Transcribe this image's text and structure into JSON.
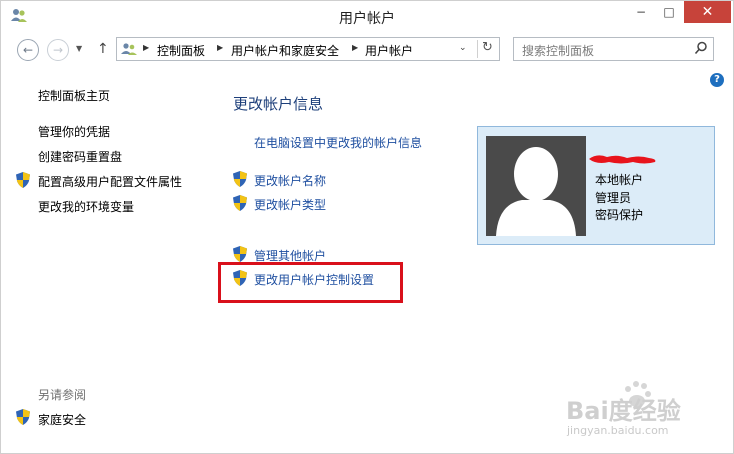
{
  "window": {
    "title": "用户帐户",
    "controls": {
      "minimize": "−",
      "maximize": "□",
      "close": "✕"
    }
  },
  "nav": {
    "back_icon": "←",
    "forward_icon": "→",
    "history_icon": "▼",
    "up_icon": "↑",
    "refresh_icon": "↻",
    "dropdown_icon": "⌄",
    "breadcrumb": [
      "控制面板",
      "用户帐户和家庭安全",
      "用户帐户"
    ],
    "search_placeholder": "搜索控制面板"
  },
  "help_icon": "?",
  "sidebar": {
    "home": "控制面板主页",
    "items": [
      {
        "label": "管理你的凭据",
        "shield": false
      },
      {
        "label": "创建密码重置盘",
        "shield": false
      },
      {
        "label": "配置高级用户配置文件属性",
        "shield": true
      },
      {
        "label": "更改我的环境变量",
        "shield": false
      }
    ],
    "see_also_title": "另请参阅",
    "see_also": [
      {
        "label": "家庭安全",
        "shield": true
      }
    ]
  },
  "main": {
    "heading": "更改帐户信息",
    "links": [
      {
        "label": "在电脑设置中更改我的帐户信息",
        "shield": false
      },
      {
        "label": "更改帐户名称",
        "shield": true
      },
      {
        "label": "更改帐户类型",
        "shield": true
      },
      {
        "label": "管理其他帐户",
        "shield": true
      },
      {
        "label": "更改用户帐户控制设置",
        "shield": true
      }
    ]
  },
  "account": {
    "lines": [
      "本地帐户",
      "管理员",
      "密码保护"
    ]
  },
  "watermark": {
    "logo_text": "Bai度经验",
    "url": "jingyan.baidu.com"
  },
  "colors": {
    "link": "#1f4fa0",
    "heading": "#1d3f7a",
    "highlight": "#d9101b",
    "card_bg": "#dcecf8",
    "close_bg": "#c7433a"
  }
}
